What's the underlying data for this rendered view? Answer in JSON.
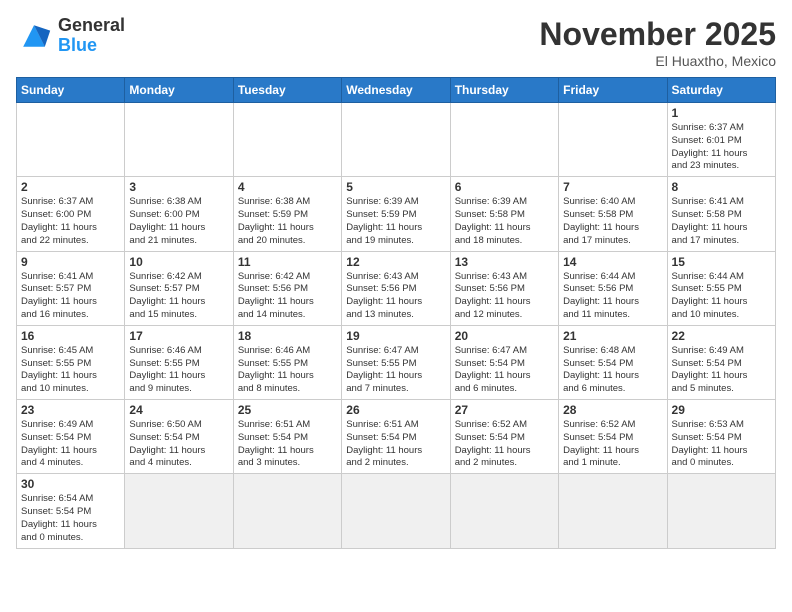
{
  "logo": {
    "general": "General",
    "blue": "Blue"
  },
  "header": {
    "month": "November 2025",
    "location": "El Huaxtho, Mexico"
  },
  "weekdays": [
    "Sunday",
    "Monday",
    "Tuesday",
    "Wednesday",
    "Thursday",
    "Friday",
    "Saturday"
  ],
  "weeks": [
    [
      {
        "day": "",
        "info": ""
      },
      {
        "day": "",
        "info": ""
      },
      {
        "day": "",
        "info": ""
      },
      {
        "day": "",
        "info": ""
      },
      {
        "day": "",
        "info": ""
      },
      {
        "day": "",
        "info": ""
      },
      {
        "day": "1",
        "info": "Sunrise: 6:37 AM\nSunset: 6:01 PM\nDaylight: 11 hours\nand 23 minutes."
      }
    ],
    [
      {
        "day": "2",
        "info": "Sunrise: 6:37 AM\nSunset: 6:00 PM\nDaylight: 11 hours\nand 22 minutes."
      },
      {
        "day": "3",
        "info": "Sunrise: 6:38 AM\nSunset: 6:00 PM\nDaylight: 11 hours\nand 21 minutes."
      },
      {
        "day": "4",
        "info": "Sunrise: 6:38 AM\nSunset: 5:59 PM\nDaylight: 11 hours\nand 20 minutes."
      },
      {
        "day": "5",
        "info": "Sunrise: 6:39 AM\nSunset: 5:59 PM\nDaylight: 11 hours\nand 19 minutes."
      },
      {
        "day": "6",
        "info": "Sunrise: 6:39 AM\nSunset: 5:58 PM\nDaylight: 11 hours\nand 18 minutes."
      },
      {
        "day": "7",
        "info": "Sunrise: 6:40 AM\nSunset: 5:58 PM\nDaylight: 11 hours\nand 17 minutes."
      },
      {
        "day": "8",
        "info": "Sunrise: 6:41 AM\nSunset: 5:58 PM\nDaylight: 11 hours\nand 17 minutes."
      }
    ],
    [
      {
        "day": "9",
        "info": "Sunrise: 6:41 AM\nSunset: 5:57 PM\nDaylight: 11 hours\nand 16 minutes."
      },
      {
        "day": "10",
        "info": "Sunrise: 6:42 AM\nSunset: 5:57 PM\nDaylight: 11 hours\nand 15 minutes."
      },
      {
        "day": "11",
        "info": "Sunrise: 6:42 AM\nSunset: 5:56 PM\nDaylight: 11 hours\nand 14 minutes."
      },
      {
        "day": "12",
        "info": "Sunrise: 6:43 AM\nSunset: 5:56 PM\nDaylight: 11 hours\nand 13 minutes."
      },
      {
        "day": "13",
        "info": "Sunrise: 6:43 AM\nSunset: 5:56 PM\nDaylight: 11 hours\nand 12 minutes."
      },
      {
        "day": "14",
        "info": "Sunrise: 6:44 AM\nSunset: 5:56 PM\nDaylight: 11 hours\nand 11 minutes."
      },
      {
        "day": "15",
        "info": "Sunrise: 6:44 AM\nSunset: 5:55 PM\nDaylight: 11 hours\nand 10 minutes."
      }
    ],
    [
      {
        "day": "16",
        "info": "Sunrise: 6:45 AM\nSunset: 5:55 PM\nDaylight: 11 hours\nand 10 minutes."
      },
      {
        "day": "17",
        "info": "Sunrise: 6:46 AM\nSunset: 5:55 PM\nDaylight: 11 hours\nand 9 minutes."
      },
      {
        "day": "18",
        "info": "Sunrise: 6:46 AM\nSunset: 5:55 PM\nDaylight: 11 hours\nand 8 minutes."
      },
      {
        "day": "19",
        "info": "Sunrise: 6:47 AM\nSunset: 5:55 PM\nDaylight: 11 hours\nand 7 minutes."
      },
      {
        "day": "20",
        "info": "Sunrise: 6:47 AM\nSunset: 5:54 PM\nDaylight: 11 hours\nand 6 minutes."
      },
      {
        "day": "21",
        "info": "Sunrise: 6:48 AM\nSunset: 5:54 PM\nDaylight: 11 hours\nand 6 minutes."
      },
      {
        "day": "22",
        "info": "Sunrise: 6:49 AM\nSunset: 5:54 PM\nDaylight: 11 hours\nand 5 minutes."
      }
    ],
    [
      {
        "day": "23",
        "info": "Sunrise: 6:49 AM\nSunset: 5:54 PM\nDaylight: 11 hours\nand 4 minutes."
      },
      {
        "day": "24",
        "info": "Sunrise: 6:50 AM\nSunset: 5:54 PM\nDaylight: 11 hours\nand 4 minutes."
      },
      {
        "day": "25",
        "info": "Sunrise: 6:51 AM\nSunset: 5:54 PM\nDaylight: 11 hours\nand 3 minutes."
      },
      {
        "day": "26",
        "info": "Sunrise: 6:51 AM\nSunset: 5:54 PM\nDaylight: 11 hours\nand 2 minutes."
      },
      {
        "day": "27",
        "info": "Sunrise: 6:52 AM\nSunset: 5:54 PM\nDaylight: 11 hours\nand 2 minutes."
      },
      {
        "day": "28",
        "info": "Sunrise: 6:52 AM\nSunset: 5:54 PM\nDaylight: 11 hours\nand 1 minute."
      },
      {
        "day": "29",
        "info": "Sunrise: 6:53 AM\nSunset: 5:54 PM\nDaylight: 11 hours\nand 0 minutes."
      }
    ],
    [
      {
        "day": "30",
        "info": "Sunrise: 6:54 AM\nSunset: 5:54 PM\nDaylight: 11 hours\nand 0 minutes."
      },
      {
        "day": "",
        "info": ""
      },
      {
        "day": "",
        "info": ""
      },
      {
        "day": "",
        "info": ""
      },
      {
        "day": "",
        "info": ""
      },
      {
        "day": "",
        "info": ""
      },
      {
        "day": "",
        "info": ""
      }
    ]
  ]
}
